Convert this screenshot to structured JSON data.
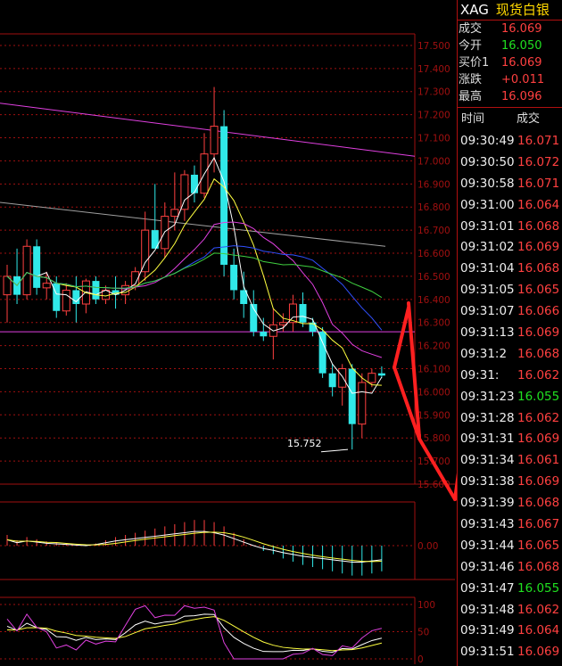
{
  "instrument": {
    "symbol": "XAG",
    "name": "现货白银"
  },
  "quote": [
    {
      "label": "成交",
      "value": "16.069",
      "color": "red"
    },
    {
      "label": "今开",
      "value": "16.050",
      "color": "green"
    },
    {
      "label": "买价1",
      "value": "16.069",
      "color": "red"
    },
    {
      "label": "涨跌",
      "value": "+0.011",
      "color": "red"
    },
    {
      "label": "最高",
      "value": "16.096",
      "color": "red"
    }
  ],
  "ticks_header": {
    "time": "时间",
    "price": "成交"
  },
  "ticks": [
    {
      "time": "09:30:49",
      "price": "16.071",
      "color": "red"
    },
    {
      "time": "09:30:50",
      "price": "16.072",
      "color": "red"
    },
    {
      "time": "09:30:58",
      "price": "16.071",
      "color": "red"
    },
    {
      "time": "09:31:00",
      "price": "16.064",
      "color": "red"
    },
    {
      "time": "09:31:01",
      "price": "16.068",
      "color": "red"
    },
    {
      "time": "09:31:02",
      "price": "16.069",
      "color": "red"
    },
    {
      "time": "09:31:04",
      "price": "16.068",
      "color": "red"
    },
    {
      "time": "09:31:05",
      "price": "16.065",
      "color": "red"
    },
    {
      "time": "09:31:07",
      "price": "16.066",
      "color": "red"
    },
    {
      "time": "09:31:13",
      "price": "16.069",
      "color": "red"
    },
    {
      "time": "09:31:2",
      "price": "16.068",
      "color": "red"
    },
    {
      "time": "09:31:",
      "price": "16.062",
      "color": "red"
    },
    {
      "time": "09:31:23",
      "price": "16.055",
      "color": "green"
    },
    {
      "time": "09:31:28",
      "price": "16.062",
      "color": "red"
    },
    {
      "time": "09:31:31",
      "price": "16.069",
      "color": "red"
    },
    {
      "time": "09:31:34",
      "price": "16.061",
      "color": "red"
    },
    {
      "time": "09:31:38",
      "price": "16.069",
      "color": "red"
    },
    {
      "time": "09:31:39",
      "price": "16.068",
      "color": "red"
    },
    {
      "time": "09:31:43",
      "price": "16.067",
      "color": "red"
    },
    {
      "time": "09:31:44",
      "price": "16.065",
      "color": "red"
    },
    {
      "time": "09:31:46",
      "price": "16.068",
      "color": "red"
    },
    {
      "time": "09:31:47",
      "price": "16.055",
      "color": "green"
    },
    {
      "time": "09:31:48",
      "price": "16.062",
      "color": "red"
    },
    {
      "time": "09:31:49",
      "price": "16.064",
      "color": "red"
    },
    {
      "time": "09:31:51",
      "price": "16.069",
      "color": "red"
    }
  ],
  "colors": {
    "up": "#ff4040",
    "down": "#30e8e8",
    "grid": "#a01010",
    "green": "#20e020",
    "name": "#ffd800"
  },
  "chart_data": [
    {
      "type": "candlestick",
      "price_axis": [
        "17.500",
        "17.400",
        "17.300",
        "17.200",
        "17.100",
        "17.000",
        "16.900",
        "16.800",
        "16.700",
        "16.600",
        "16.500",
        "16.400",
        "16.300",
        "16.200",
        "16.100",
        "16.000",
        "15.900",
        "15.800",
        "15.700",
        "15.600"
      ],
      "ylim": [
        15.6,
        17.55
      ],
      "annotation": "15.752",
      "candles": [
        {
          "o": 16.42,
          "h": 16.55,
          "l": 16.3,
          "c": 16.5
        },
        {
          "o": 16.5,
          "h": 16.62,
          "l": 16.38,
          "c": 16.42
        },
        {
          "o": 16.42,
          "h": 16.66,
          "l": 16.4,
          "c": 16.63
        },
        {
          "o": 16.63,
          "h": 16.66,
          "l": 16.42,
          "c": 16.45
        },
        {
          "o": 16.45,
          "h": 16.52,
          "l": 16.4,
          "c": 16.47
        },
        {
          "o": 16.47,
          "h": 16.5,
          "l": 16.32,
          "c": 16.35
        },
        {
          "o": 16.35,
          "h": 16.47,
          "l": 16.33,
          "c": 16.44
        },
        {
          "o": 16.44,
          "h": 16.5,
          "l": 16.3,
          "c": 16.38
        },
        {
          "o": 16.38,
          "h": 16.49,
          "l": 16.34,
          "c": 16.48
        },
        {
          "o": 16.48,
          "h": 16.5,
          "l": 16.38,
          "c": 16.4
        },
        {
          "o": 16.4,
          "h": 16.46,
          "l": 16.38,
          "c": 16.44
        },
        {
          "o": 16.44,
          "h": 16.5,
          "l": 16.36,
          "c": 16.42
        },
        {
          "o": 16.42,
          "h": 16.48,
          "l": 16.38,
          "c": 16.46
        },
        {
          "o": 16.46,
          "h": 16.54,
          "l": 16.44,
          "c": 16.52
        },
        {
          "o": 16.52,
          "h": 16.78,
          "l": 16.48,
          "c": 16.7
        },
        {
          "o": 16.7,
          "h": 16.9,
          "l": 16.62,
          "c": 16.62
        },
        {
          "o": 16.62,
          "h": 16.82,
          "l": 16.58,
          "c": 16.76
        },
        {
          "o": 16.76,
          "h": 16.95,
          "l": 16.7,
          "c": 16.79
        },
        {
          "o": 16.79,
          "h": 16.96,
          "l": 16.74,
          "c": 16.94
        },
        {
          "o": 16.94,
          "h": 16.98,
          "l": 16.82,
          "c": 16.86
        },
        {
          "o": 16.86,
          "h": 17.12,
          "l": 16.84,
          "c": 17.03
        },
        {
          "o": 17.03,
          "h": 17.32,
          "l": 16.95,
          "c": 17.15
        },
        {
          "o": 17.15,
          "h": 17.22,
          "l": 16.5,
          "c": 16.55
        },
        {
          "o": 16.55,
          "h": 16.62,
          "l": 16.4,
          "c": 16.44
        },
        {
          "o": 16.44,
          "h": 16.52,
          "l": 16.32,
          "c": 16.38
        },
        {
          "o": 16.38,
          "h": 16.44,
          "l": 16.24,
          "c": 16.26
        },
        {
          "o": 16.26,
          "h": 16.32,
          "l": 16.22,
          "c": 16.24
        },
        {
          "o": 16.24,
          "h": 16.36,
          "l": 16.14,
          "c": 16.29
        },
        {
          "o": 16.29,
          "h": 16.34,
          "l": 16.26,
          "c": 16.3
        },
        {
          "o": 16.3,
          "h": 16.42,
          "l": 16.26,
          "c": 16.38
        },
        {
          "o": 16.38,
          "h": 16.43,
          "l": 16.28,
          "c": 16.3
        },
        {
          "o": 16.3,
          "h": 16.32,
          "l": 16.24,
          "c": 16.26
        },
        {
          "o": 16.26,
          "h": 16.28,
          "l": 16.06,
          "c": 16.08
        },
        {
          "o": 16.08,
          "h": 16.12,
          "l": 15.98,
          "c": 16.02
        },
        {
          "o": 16.02,
          "h": 16.12,
          "l": 15.94,
          "c": 16.1
        },
        {
          "o": 16.1,
          "h": 16.12,
          "l": 15.75,
          "c": 15.86
        },
        {
          "o": 15.86,
          "h": 16.08,
          "l": 15.8,
          "c": 16.04
        },
        {
          "o": 16.04,
          "h": 16.1,
          "l": 16.02,
          "c": 16.08
        },
        {
          "o": 16.08,
          "h": 16.11,
          "l": 16.06,
          "c": 16.07
        }
      ]
    },
    {
      "type": "bar",
      "axis_label": "0.00",
      "values": [
        0.1,
        0.05,
        0.08,
        0.06,
        0.04,
        0.03,
        0.02,
        0.01,
        0.0,
        0.02,
        0.05,
        0.08,
        0.1,
        0.12,
        0.14,
        0.16,
        0.18,
        0.2,
        0.22,
        0.24,
        0.24,
        0.22,
        0.18,
        0.12,
        0.06,
        0.0,
        -0.05,
        -0.08,
        -0.12,
        -0.15,
        -0.18,
        -0.2,
        -0.22,
        -0.24,
        -0.26,
        -0.28,
        -0.28,
        -0.26,
        -0.24
      ]
    },
    {
      "type": "line",
      "axis_labels": [
        "100",
        "50",
        "0"
      ],
      "ylim": [
        0,
        100
      ]
    }
  ]
}
